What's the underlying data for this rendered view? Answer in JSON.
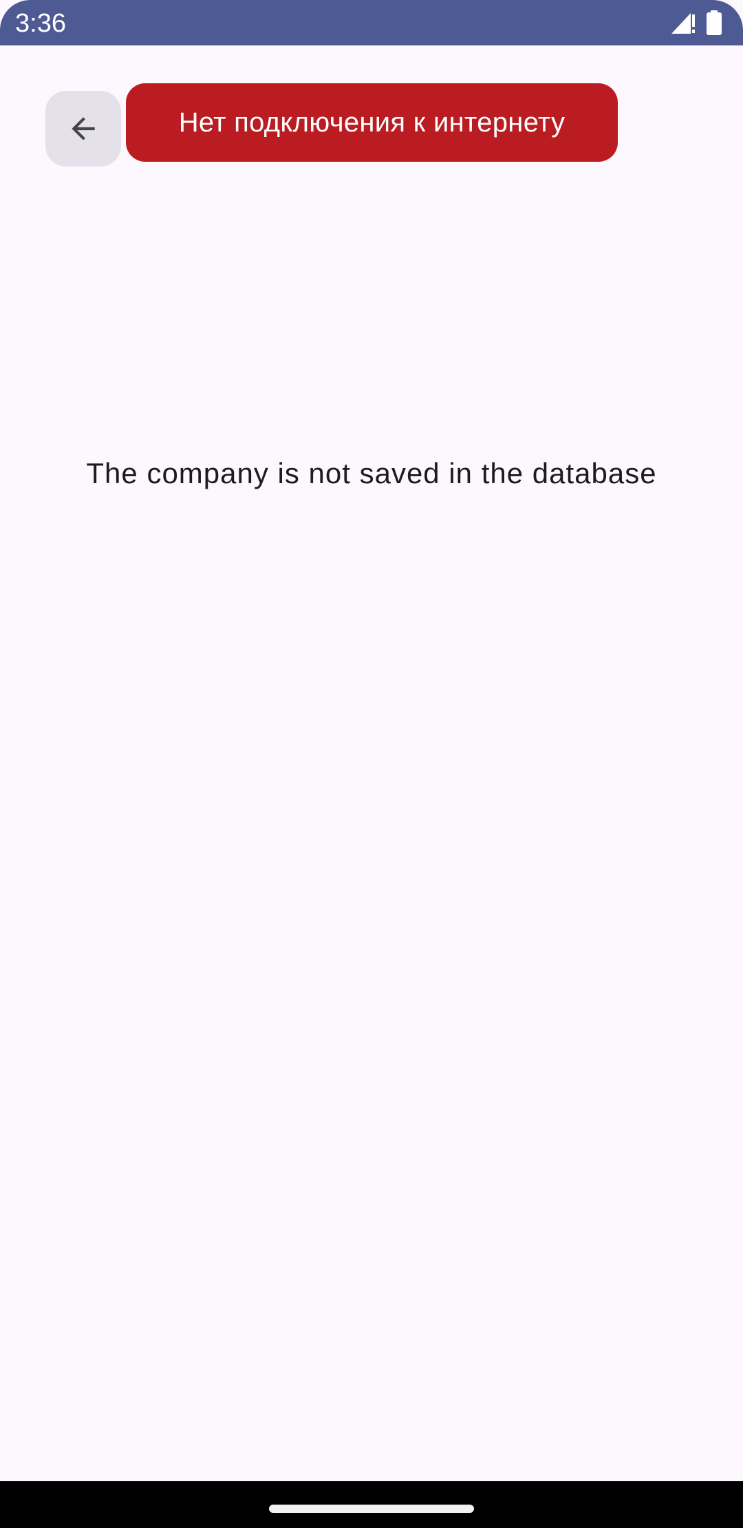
{
  "status_bar": {
    "time": "3:36",
    "background_color": "#4E5A93",
    "icons": [
      "signal-alert-icon",
      "battery-icon"
    ]
  },
  "toolbar": {
    "back_icon": "arrow-back-icon"
  },
  "error_banner": {
    "text": "Нет подключения к интернету",
    "color": "#BA1C21"
  },
  "main": {
    "message": "The company is not saved in the database"
  },
  "navigation": {
    "handle": "gesture-home-handle"
  }
}
